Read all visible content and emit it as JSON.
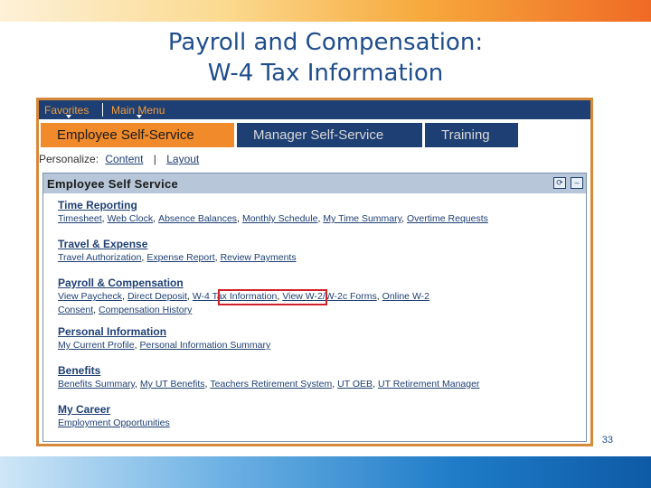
{
  "slide": {
    "title_line1": "Payroll and Compensation:",
    "title_line2": "W-4 Tax Information",
    "page_number": "33"
  },
  "menu": {
    "favorites": "Favorites",
    "main_menu": "Main Menu"
  },
  "tabs": {
    "employee": "Employee Self-Service",
    "manager": "Manager Self-Service",
    "training": "Training"
  },
  "personalize": {
    "label": "Personalize:",
    "content": "Content",
    "sep": "|",
    "layout": "Layout"
  },
  "pane": {
    "title": "Employee Self Service",
    "refresh_icon": "refresh-icon",
    "minimize_icon": "minimize-icon",
    "sections": {
      "time": {
        "title": "Time Reporting",
        "links": [
          "Timesheet",
          "Web Clock",
          "Absence Balances",
          "Monthly Schedule",
          "My Time Summary",
          "Overtime Requests"
        ]
      },
      "travel": {
        "title": "Travel & Expense",
        "links": [
          "Travel Authorization",
          "Expense Report",
          "Review Payments"
        ]
      },
      "payroll": {
        "title": "Payroll & Compensation",
        "links": [
          "View Paycheck",
          "Direct Deposit",
          "W-4 Tax Information",
          "View W-2/W-2c Forms",
          "Online W-2",
          "Consent",
          "Compensation History"
        ]
      },
      "personal": {
        "title": "Personal Information",
        "links": [
          "My Current Profile",
          "Personal Information Summary"
        ]
      },
      "benefits": {
        "title": "Benefits",
        "links": [
          "Benefits Summary",
          "My UT Benefits",
          "Teachers Retirement System",
          "UT OEB",
          "UT Retirement Manager"
        ]
      },
      "career": {
        "title": "My Career",
        "links": [
          "Employment Opportunities"
        ]
      }
    }
  },
  "colors": {
    "highlight": "#d0202a",
    "nav": "#1e3f73",
    "accent": "#f08a2b"
  }
}
